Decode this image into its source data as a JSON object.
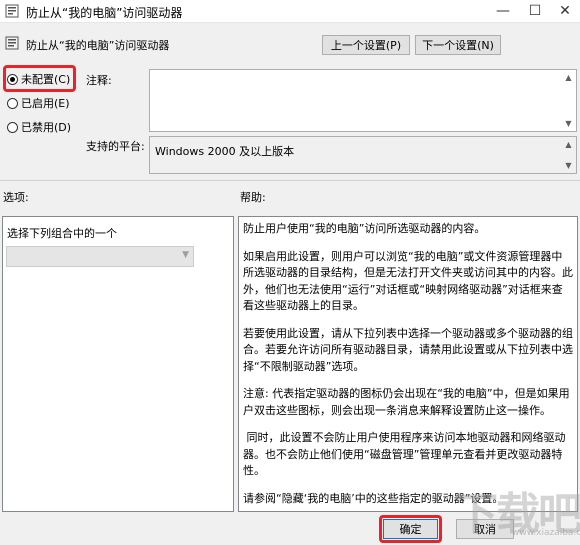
{
  "window": {
    "title": "防止从“我的电脑”访问驱动器",
    "min_glyph": "—",
    "max_glyph": "☐",
    "close_glyph": "✕"
  },
  "header": {
    "policy_name": "防止从“我的电脑”访问驱动器",
    "prev_button": "上一个设置(P)",
    "next_button": "下一个设置(N)"
  },
  "state": {
    "options": [
      {
        "label": "未配置(C)",
        "checked": true
      },
      {
        "label": "已启用(E)",
        "checked": false
      },
      {
        "label": "已禁用(D)",
        "checked": false
      }
    ]
  },
  "comment": {
    "label": "注释:",
    "value": ""
  },
  "platform": {
    "label": "支持的平台:",
    "value": "Windows 2000 及以上版本"
  },
  "options_panel": {
    "label": "选项:",
    "combo_caption": "选择下列组合中的一个",
    "combo_value": ""
  },
  "help_panel": {
    "label": "帮助:",
    "paragraphs": [
      "防止用户使用“我的电脑”访问所选驱动器的内容。",
      "如果启用此设置，则用户可以浏览“我的电脑”或文件资源管理器中所选驱动器的目录结构，但是无法打开文件夹或访问其中的内容。此外，他们也无法使用“运行”对话框或“映射网络驱动器”对话框来查看这些驱动器上的目录。",
      "若要使用此设置，请从下拉列表中选择一个驱动器或多个驱动器的组合。若要允许访问所有驱动器目录，请禁用此设置或从下拉列表中选择“不限制驱动器”选项。",
      "注意: 代表指定驱动器的图标仍会出现在“我的电脑”中，但是如果用户双击这些图标，则会出现一条消息来解释设置防止这一操作。",
      " 同时，此设置不会防止用户使用程序来访问本地驱动器和网络驱动器。也不会防止他们使用“磁盘管理”管理单元查看并更改驱动器特性。",
      "请参阅“隐藏‘我的电脑’中的这些指定的驱动器”设置。"
    ]
  },
  "footer": {
    "ok_button": "确定",
    "cancel_button": "取消"
  },
  "watermark": {
    "text": "下载吧",
    "url": "www.xiazaiba.com"
  },
  "colors": {
    "highlight": "#e8232a",
    "focus_border": "#0078d7"
  }
}
